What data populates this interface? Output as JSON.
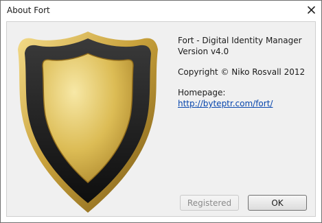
{
  "window": {
    "title": "About Fort"
  },
  "about": {
    "product": "Fort - Digital Identity Manager",
    "version": "Version v4.0",
    "copyright": "Copyright © Niko Rosvall 2012",
    "homepage_label": "Homepage:",
    "homepage_url": "http://byteptr.com/fort/"
  },
  "buttons": {
    "registered": "Registered",
    "ok": "OK"
  },
  "icons": {
    "close": "close-icon",
    "logo": "shield-icon"
  },
  "colors": {
    "shield_gold": "#d9b84e",
    "shield_rim": "#b0892c",
    "shield_border": "#1c1c1c",
    "link": "#0645ad"
  }
}
